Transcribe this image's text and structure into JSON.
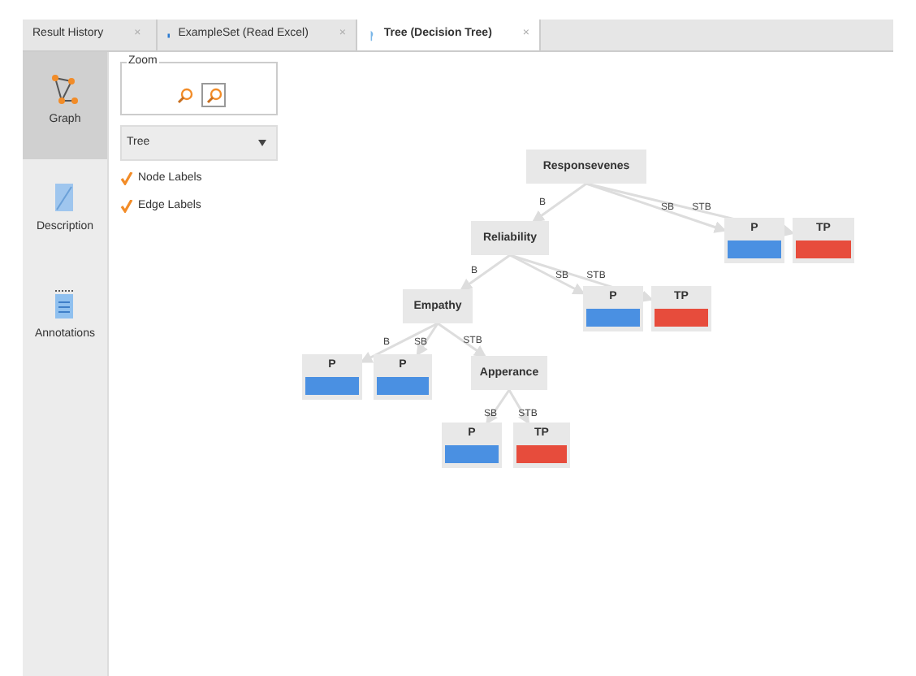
{
  "tabs": [
    {
      "label": "Result History",
      "selected": false,
      "close": "×"
    },
    {
      "label": "ExampleSet (Read Excel)",
      "selected": false,
      "close": "×"
    },
    {
      "label": "Tree (Decision Tree)",
      "selected": true,
      "close": "×"
    }
  ],
  "side_views": [
    {
      "label": "Graph",
      "selected": true
    },
    {
      "label": "Description",
      "selected": false
    },
    {
      "label": "Annotations",
      "selected": false
    }
  ],
  "zoom": {
    "title": "Zoom",
    "buttons": [
      {
        "selected": false
      },
      {
        "selected": true
      }
    ]
  },
  "layout_select": {
    "value": "Tree"
  },
  "options": [
    {
      "label": "Node Labels",
      "checked": true
    },
    {
      "label": "Edge Labels",
      "checked": true
    }
  ],
  "tree": {
    "label": "Responsevenes",
    "children": [
      {
        "edge": "B",
        "node": {
          "label": "Reliability",
          "children": [
            {
              "edge": "B",
              "node": {
                "label": "Empathy",
                "children": [
                  {
                    "edge": "B",
                    "node": {
                      "label": "P",
                      "color": "#4a90e2"
                    }
                  },
                  {
                    "edge": "SB",
                    "node": {
                      "label": "P",
                      "color": "#4a90e2"
                    }
                  },
                  {
                    "edge": "STB",
                    "node": {
                      "label": "Apperance",
                      "children": [
                        {
                          "edge": "SB",
                          "node": {
                            "label": "P",
                            "color": "#4a90e2"
                          }
                        },
                        {
                          "edge": "STB",
                          "node": {
                            "label": "TP",
                            "color": "#e74c3c"
                          }
                        }
                      ]
                    }
                  }
                ]
              }
            },
            {
              "edge": "SB",
              "node": {
                "label": "P",
                "color": "#4a90e2"
              }
            },
            {
              "edge": "STB",
              "node": {
                "label": "TP",
                "color": "#e74c3c"
              }
            }
          ]
        }
      },
      {
        "edge": "SB",
        "node": {
          "label": "P",
          "color": "#4a90e2"
        }
      },
      {
        "edge": "STB",
        "node": {
          "label": "TP",
          "color": "#e74c3c"
        }
      }
    ]
  }
}
